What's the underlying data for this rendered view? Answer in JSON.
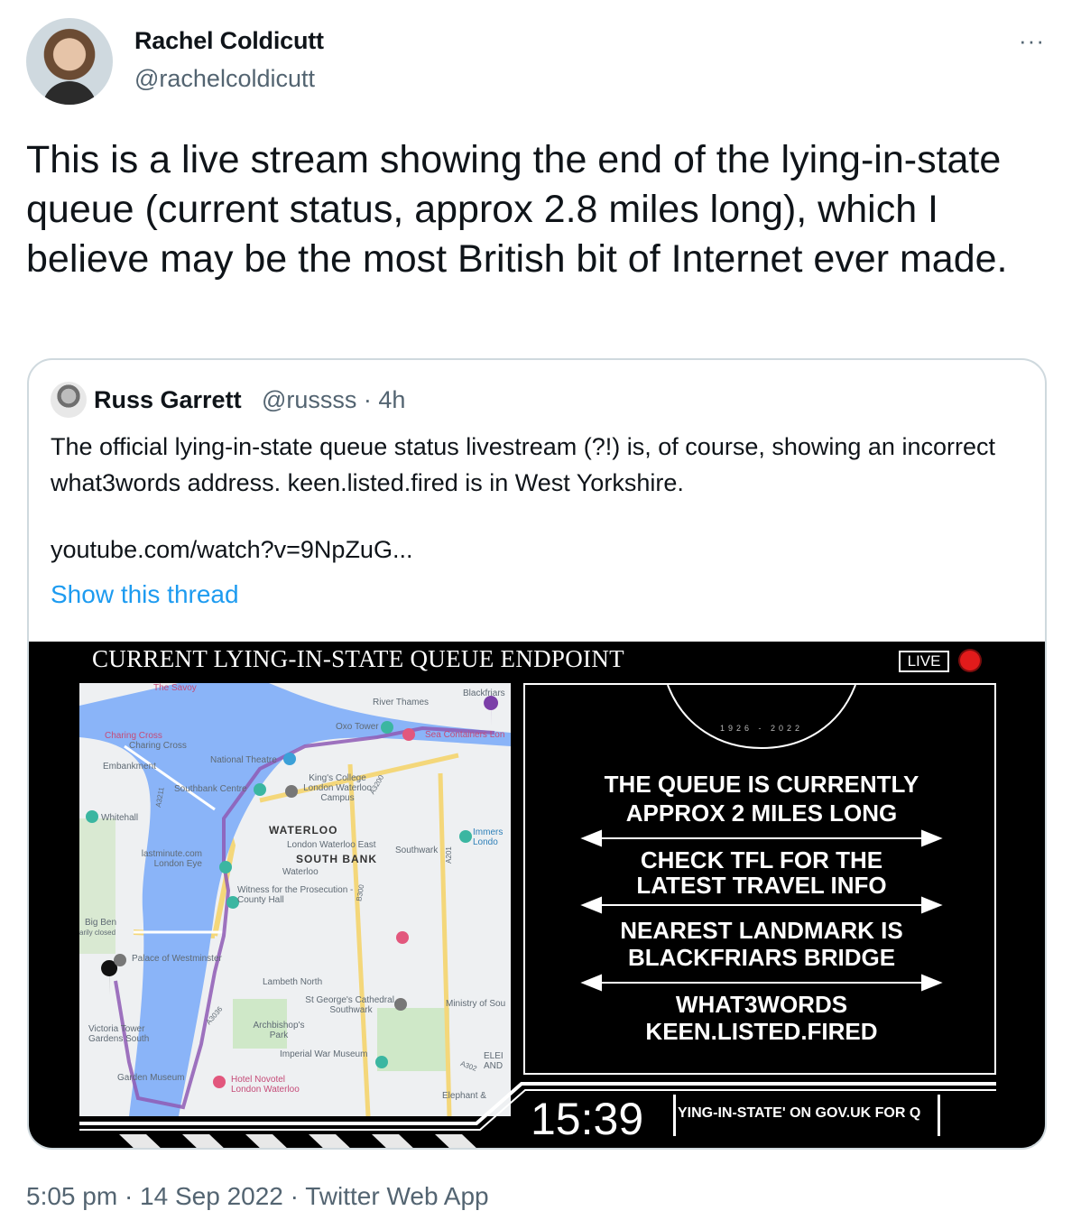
{
  "tweet": {
    "author_name": "Rachel Coldicutt",
    "author_handle": "@rachelcoldicutt",
    "more_label": "···",
    "text": "This is a live stream showing the end of the lying-in-state queue (current status, approx 2.8 miles long), which I believe may be the most British bit of Internet ever made.",
    "timestamp": "5:05 pm · 14 Sep 2022 · Twitter Web App"
  },
  "quoted": {
    "author_name": "Russ Garrett",
    "meta": "@russss · 4h",
    "text": "The official lying-in-state queue status livestream (?!) is, of course, showing an incorrect what3words address. keen.listed.fired is in West Yorkshire.",
    "link": "youtube.com/watch?v=9NpZuG...",
    "show_thread": "Show this thread"
  },
  "stream": {
    "title": "CURRENT LYING-IN-STATE QUEUE ENDPOINT",
    "live_label": "LIVE",
    "years": "1926 - 2022",
    "lines": [
      [
        "THE QUEUE IS CURRENTLY",
        "APPROX 2 MILES LONG"
      ],
      [
        "CHECK TFL FOR THE",
        "LATEST TRAVEL INFO"
      ],
      [
        "NEAREST LANDMARK IS",
        "BLACKFRIARS BRIDGE"
      ],
      [
        "WHAT3WORDS",
        "KEEN.LISTED.FIRED"
      ]
    ],
    "clock": "15:39",
    "ticker": "YING-IN-STATE' ON GOV.UK FOR Q"
  },
  "map": {
    "labels": {
      "savoy": "The Savoy",
      "river_thames": "River Thames",
      "blackfriars": "Blackfriars",
      "oxo_tower": "Oxo Tower",
      "sea_containers": "Sea Containers Lon",
      "charing_cross_1": "Charing Cross",
      "charing_cross_2": "Charing Cross",
      "national_theatre": "National Theatre",
      "embankment": "Embankment",
      "kings_college": "King's College London Waterloo Campus",
      "southbank_centre": "Southbank Centre",
      "whitehall": "Whitehall",
      "waterloo": "WATERLOO",
      "immersive": "Immers Londo",
      "waterloo_east": "London Waterloo East",
      "south_bank": "SOUTH BANK",
      "southwark": "Southwark",
      "lastminute": "lastminute.com London Eye",
      "waterloo_stn": "Waterloo",
      "witness": "Witness for the Prosecution - County Hall",
      "big_ben": "Big Ben",
      "big_ben_sub": "arily closed",
      "palace": "Palace of Westminster",
      "lambeth_north": "Lambeth North",
      "st_georges": "St George's Cathedral, Southwark",
      "ministry": "Ministry of Sou",
      "victoria_tower": "Victoria Tower Gardens South",
      "archbishops": "Archbishop's Park",
      "iwm": "Imperial War Museum",
      "elephant_castle": "ELEI AND",
      "garden_museum": "Garden Museum",
      "novotel": "Hotel Novotel London Waterloo",
      "elephant": "Elephant &",
      "road_a3200": "A3200",
      "road_a3211": "A3211",
      "road_a201": "A201",
      "road_a3036": "A3036",
      "road_b300": "B300",
      "road_a302": "A302"
    }
  },
  "colors": {
    "link_blue": "#1d9bf0",
    "secondary_text": "#536471",
    "route": "#8e5bb5",
    "river": "#8ab4f8",
    "live_red": "#e21b1b"
  }
}
